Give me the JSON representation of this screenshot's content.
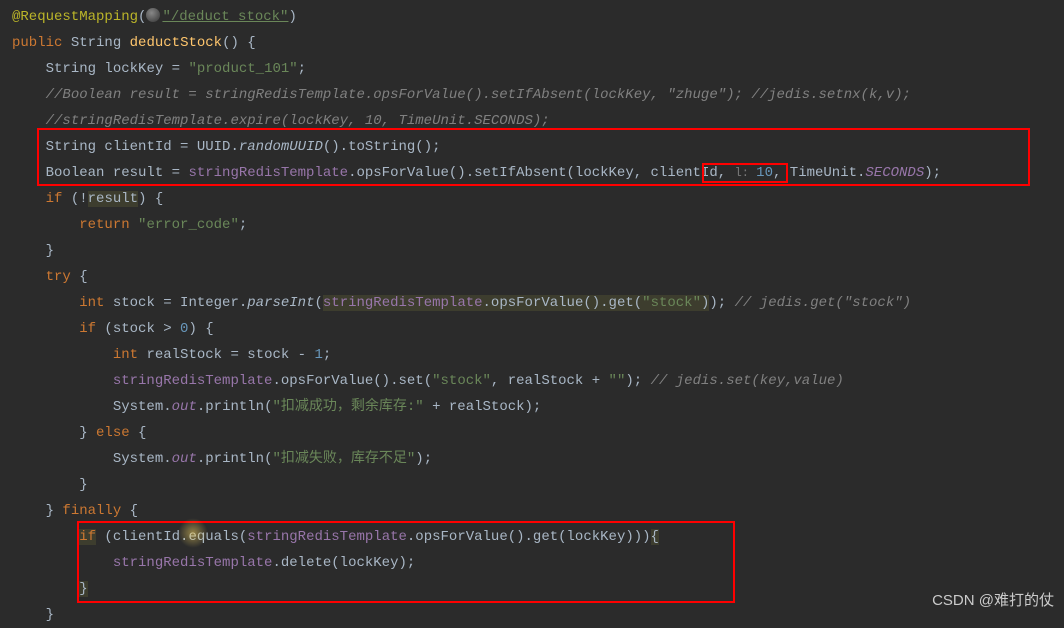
{
  "code": {
    "line1": {
      "annotation": "@RequestMapping",
      "paren_open": "(",
      "path": "\"/deduct_stock\"",
      "paren_close": ")"
    },
    "line2": {
      "kw_public": "public",
      "type": "String",
      "method": "deductStock",
      "rest": "() {"
    },
    "line3": {
      "type": "String",
      "var": " lockKey = ",
      "str": "\"product_101\"",
      "semi": ";"
    },
    "line4": {
      "comment": "//Boolean result = stringRedisTemplate.opsForValue().setIfAbsent(lockKey, \"zhuge\"); //jedis.setnx(k,v);"
    },
    "line5": {
      "comment": "//stringRedisTemplate.expire(lockKey, 10, TimeUnit.SECONDS);"
    },
    "line6": {
      "type": "String",
      "var": " clientId = UUID.",
      "smethod": "randomUUID",
      "rest": "().toString();"
    },
    "line7": {
      "type": "Boolean",
      "var": " result = ",
      "field": "stringRedisTemplate",
      "call1": ".opsForValue().setIfAbsent(lockKey, ",
      "client": "clientId",
      "comma": ", ",
      "hint": "l: ",
      "num": "10",
      "comma2": ", TimeUnit.",
      "sfield": "SECONDS",
      "end": ");"
    },
    "line8": {
      "kw_if": "if",
      "rest1": " (!",
      "hl": "result",
      "rest2": ") {"
    },
    "line9": {
      "kw_return": "return",
      "sp": " ",
      "str": "\"error_code\"",
      "semi": ";"
    },
    "line10": {
      "brace": "}"
    },
    "line11": {
      "kw_try": "try",
      "rest": " {"
    },
    "line12": {
      "kw_int": "int",
      "var": " stock = Integer.",
      "smethod": "parseInt",
      "paren": "(",
      "field": "stringRedisTemplate",
      "call": ".opsForValue().get(",
      "str": "\"stock\"",
      "close": ")); ",
      "comment": "// jedis.get(\"stock\")"
    },
    "line13": {
      "kw_if": "if",
      "rest": " (stock > ",
      "num": "0",
      "rest2": ") {"
    },
    "line14": {
      "kw_int": "int",
      "rest": " realStock = stock - ",
      "num": "1",
      "semi": ";"
    },
    "line15": {
      "field": "stringRedisTemplate",
      "call": ".opsForValue().set(",
      "str1": "\"stock\"",
      "mid": ", realStock + ",
      "str2": "\"\"",
      "close": "); ",
      "comment": "// jedis.set(key,value)"
    },
    "line16": {
      "sys": "System.",
      "out": "out",
      "call": ".println(",
      "str": "\"扣减成功，剩余库存:\"",
      "rest": " + realStock);"
    },
    "line17": {
      "close": "} ",
      "kw_else": "else",
      "rest": " {"
    },
    "line18": {
      "sys": "System.",
      "out": "out",
      "call": ".println(",
      "str": "\"扣减失败，库存不足\"",
      "rest": ");"
    },
    "line19": {
      "brace": "}"
    },
    "line20": {
      "close": "} ",
      "kw_finally": "finally",
      "rest": " {"
    },
    "line21": {
      "kw_if": "if",
      "rest1": " (clientId.equals(",
      "field": "stringRedisTemplate",
      "call": ".opsForValue().get(lockKey)))",
      "brace": "{"
    },
    "line22": {
      "field": "stringRedisTemplate",
      "call": ".delete(lockKey);"
    },
    "line23": {
      "brace": "}"
    },
    "line24": {
      "brace": "}"
    }
  },
  "watermark": "CSDN @难打的仗"
}
